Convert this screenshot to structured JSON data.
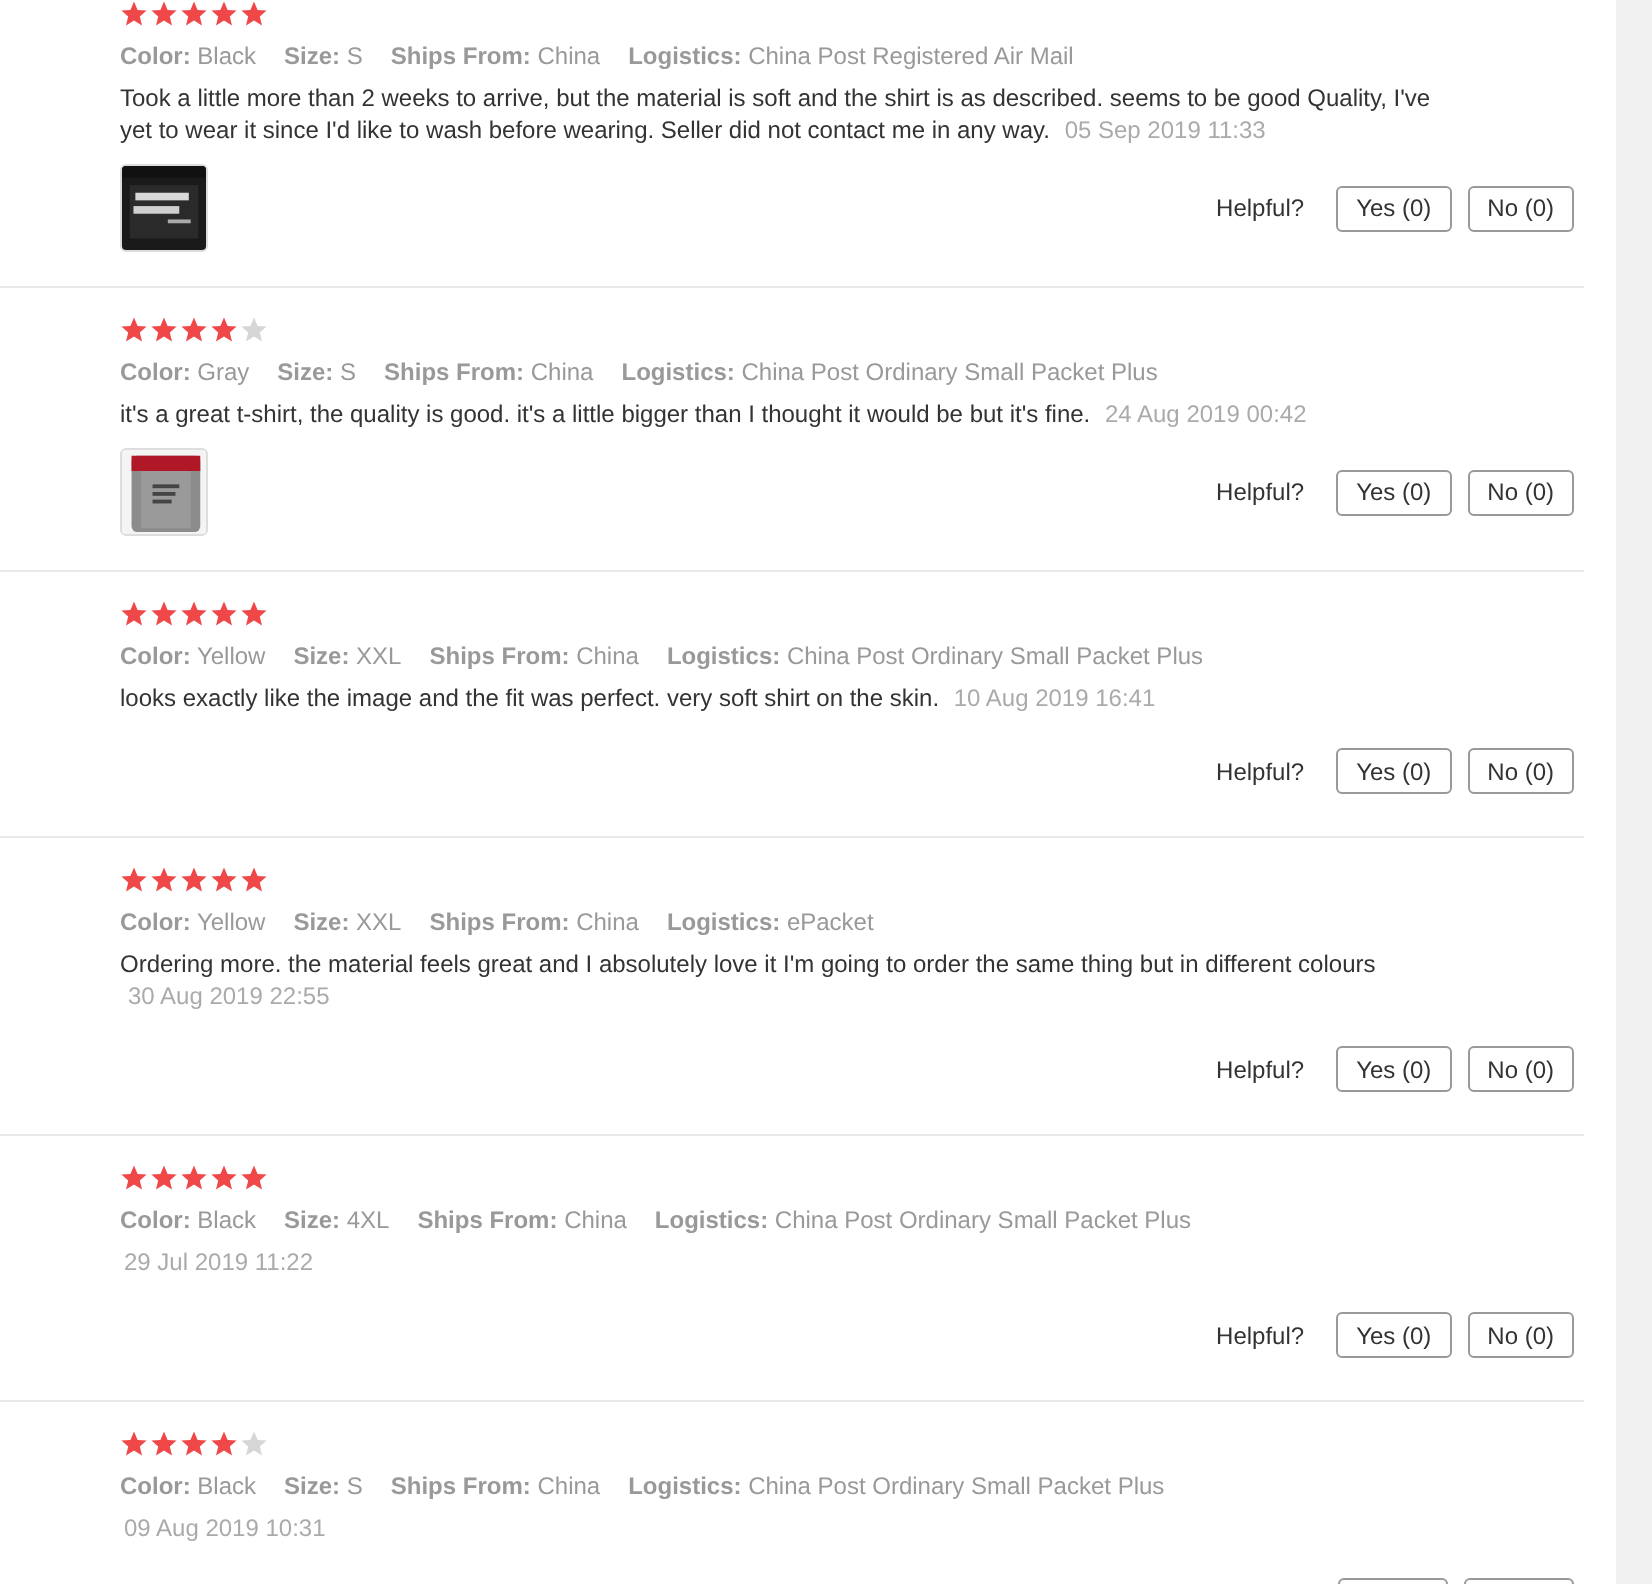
{
  "reviews": [
    {
      "stars": 5,
      "meta": [
        "**Color:** Black",
        "**Size:** S",
        "**Ships From:** China",
        "**Logistics:** China Post Registered Air Mail"
      ],
      "text": "Took a little more than 2 weeks to arrive, but the material is soft and the shirt is as described. seems to be good Quality, I've yet to wear it since I'd like to wash before wearing. Seller did not contact me in any way.",
      "date": "05 Sep 2019 11:33",
      "helpful": "Helpful?",
      "yes": "Yes (0)",
      "no": "No (0)"
    },
    {
      "stars": 4,
      "meta": [
        "**Color:** Gray",
        "**Size:** S",
        "**Ships From:** China",
        "**Logistics:** China Post Ordinary Small Packet Plus"
      ],
      "text": "it's a great t-shirt, the quality is good. it's a little bigger than I thought it would be but it's fine.",
      "date": "24 Aug 2019 00:42",
      "helpful": "Helpful?",
      "yes": "Yes (0)",
      "no": "No (0)"
    },
    {
      "stars": 5,
      "meta": [
        "**Color:** Yellow",
        "**Size:** XXL",
        "**Ships From:** China",
        "**Logistics:** China Post Ordinary Small Packet Plus"
      ],
      "text": "looks exactly like the image and the fit was perfect. very soft shirt on the skin.",
      "date": "10 Aug 2019 16:41",
      "helpful": "Helpful?",
      "yes": "Yes (0)",
      "no": "No (0)"
    },
    {
      "stars": 5,
      "meta": [
        "**Color:** Yellow",
        "**Size:** XXL",
        "**Ships From:** China",
        "**Logistics:** ePacket"
      ],
      "text": "Ordering more. the material feels great and I absolutely love it I'm going to order the same thing but in different colours",
      "date": "30 Aug 2019 22:55",
      "helpful": "Helpful?",
      "yes": "Yes (0)",
      "no": "No (0)"
    },
    {
      "stars": 5,
      "meta": [
        "**Color:** Black",
        "**Size:** 4XL",
        "**Ships From:** China",
        "**Logistics:** China Post Ordinary Small Packet Plus"
      ],
      "date": "29 Jul 2019 11:22",
      "helpful": "Helpful?",
      "yes": "Yes (0)",
      "no": "No (0)"
    },
    {
      "stars": 4,
      "meta": [
        "**Color:** Black",
        "**Size:** S",
        "**Ships From:** China",
        "**Logistics:** China Post Ordinary Small Packet Plus"
      ],
      "date": "09 Aug 2019 10:31"
    }
  ]
}
